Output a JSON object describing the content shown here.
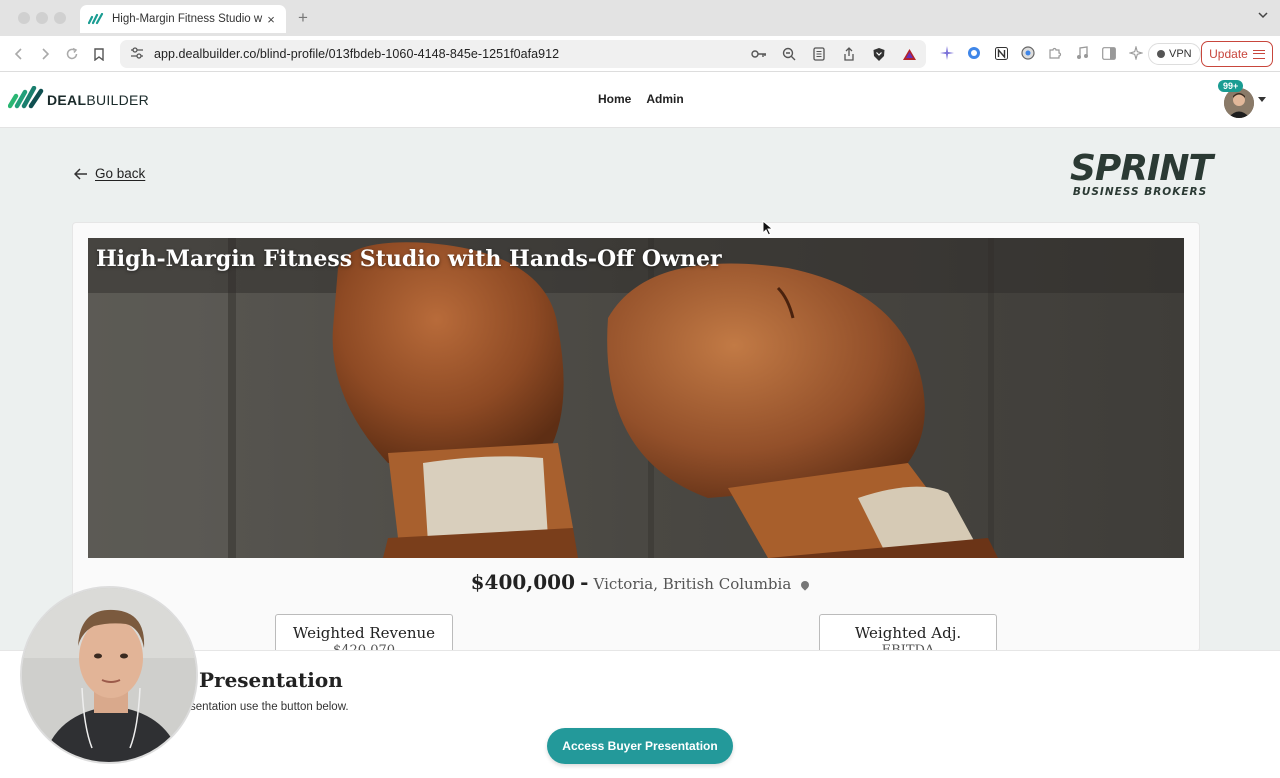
{
  "browser": {
    "tab_title": "High-Margin Fitness Studio w",
    "tab_close": "×",
    "new_tab": "+",
    "url": "app.dealbuilder.co/blind-profile/013fbdeb-1060-4148-845e-1251f0afa912",
    "vpn_label": "VPN",
    "update_label": "Update",
    "tab_menu_icon": "⌄"
  },
  "header": {
    "logo_bold": "DEAL",
    "logo_light": "BUILDER",
    "nav": [
      "Home",
      "Admin"
    ],
    "notification_badge": "99+"
  },
  "page": {
    "go_back": "Go back",
    "broker_logo_big": "SPRINT",
    "broker_logo_small": "BUSINESS BROKERS",
    "listing_title": "High-Margin Fitness Studio with Hands-Off Owner",
    "price": "$400,000",
    "price_separator": "-",
    "location": "Victoria, British Columbia",
    "metrics": [
      {
        "label": "Weighted Revenue",
        "value": "$420,070"
      },
      {
        "label": "Weighted Adj.",
        "value": "EBITDA"
      }
    ]
  },
  "presentation": {
    "heading": "Presentation",
    "subtext": "sentation use the button below.",
    "button": "Access Buyer Presentation"
  },
  "colors": {
    "accent": "#23999a",
    "badge": "#1a9c92",
    "update_red": "#c8463c"
  }
}
